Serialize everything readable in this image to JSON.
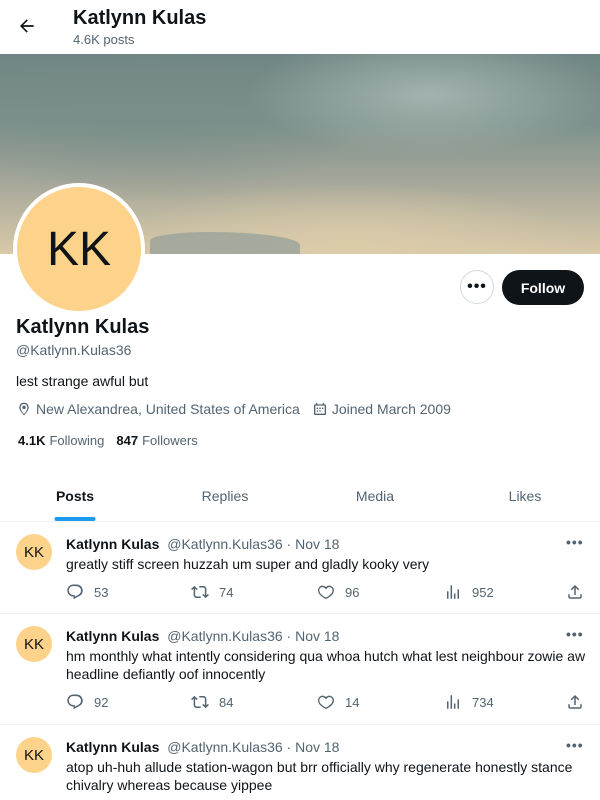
{
  "header": {
    "name": "Katlynn Kulas",
    "post_count": "4.6K posts"
  },
  "profile": {
    "avatar_initials": "KK",
    "name": "Katlynn Kulas",
    "handle": "@Katlynn.Kulas36",
    "bio": "lest strange awful but",
    "location": "New Alexandrea, United States of America",
    "joined": "Joined March 2009",
    "following_count": "4.1K",
    "following_label": "Following",
    "followers_count": "847",
    "followers_label": "Followers",
    "follow_label": "Follow",
    "more_label": "•••",
    "avatar_color": "#fdd28a"
  },
  "tabs": [
    {
      "label": "Posts",
      "active": true
    },
    {
      "label": "Replies",
      "active": false
    },
    {
      "label": "Media",
      "active": false
    },
    {
      "label": "Likes",
      "active": false
    }
  ],
  "posts": [
    {
      "avatar": "KK",
      "name": "Katlynn Kulas",
      "meta": "@Katlynn.Kulas36 · Nov 18",
      "text": "greatly stiff screen huzzah um super and gladly kooky very",
      "replies": "53",
      "reposts": "74",
      "likes": "96",
      "views": "952"
    },
    {
      "avatar": "KK",
      "name": "Katlynn Kulas",
      "meta": "@Katlynn.Kulas36 · Nov 18",
      "text": "hm monthly what intently considering qua whoa hutch what lest neighbour zowie aw headline defiantly oof innocently",
      "replies": "92",
      "reposts": "84",
      "likes": "14",
      "views": "734"
    },
    {
      "avatar": "KK",
      "name": "Katlynn Kulas",
      "meta": "@Katlynn.Kulas36 · Nov 18",
      "text": "atop uh-huh allude station-wagon but brr officially why regenerate honestly stance chivalry whereas because yippee",
      "replies": "",
      "reposts": "",
      "likes": "",
      "views": ""
    }
  ],
  "colors": {
    "accent": "#1d9bf0",
    "text": "#0f1419",
    "muted": "#536471"
  }
}
